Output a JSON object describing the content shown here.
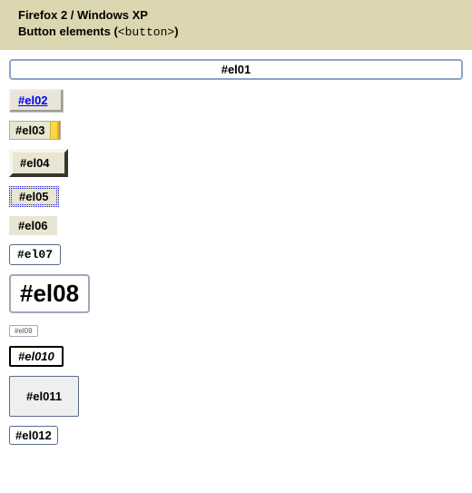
{
  "header": {
    "line1": "Firefox 2 / Windows XP",
    "line2_prefix": "Button elements (",
    "line2_code": "<button>",
    "line2_suffix": ")"
  },
  "buttons": {
    "el01": "#el01",
    "el02": "#el02",
    "el03": "#el03",
    "el04": "#el04",
    "el05": "#el05",
    "el06": "#el06",
    "el07": "#el07",
    "el08": "#el08",
    "el09": "#el09",
    "el010": "#el010",
    "el011": "#el011",
    "el012": "#el012"
  }
}
